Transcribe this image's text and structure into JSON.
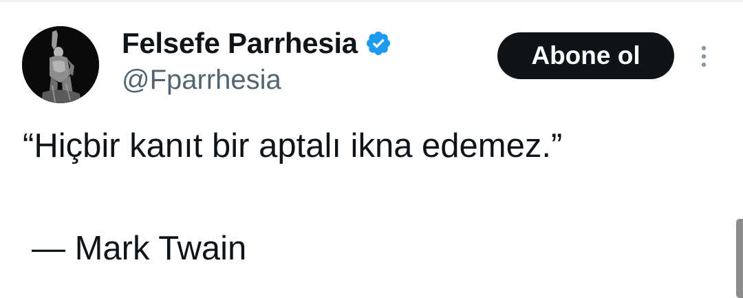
{
  "author": {
    "display_name": "Felsefe Parrhesia",
    "handle": "@Fparrhesia",
    "verified": true,
    "verified_color": "#1d9bf0",
    "avatar_icon": "statue-avatar"
  },
  "actions": {
    "follow_label": "Abone ol",
    "more_icon": "more-vertical-icon"
  },
  "tweet": {
    "text": "“Hiçbir kanıt bir aptalı ikna edemez.”",
    "attribution": "— Mark Twain"
  },
  "colors": {
    "text": "#0f1419",
    "secondary_text": "#536471",
    "button_bg": "#0f1419",
    "button_text": "#ffffff"
  }
}
